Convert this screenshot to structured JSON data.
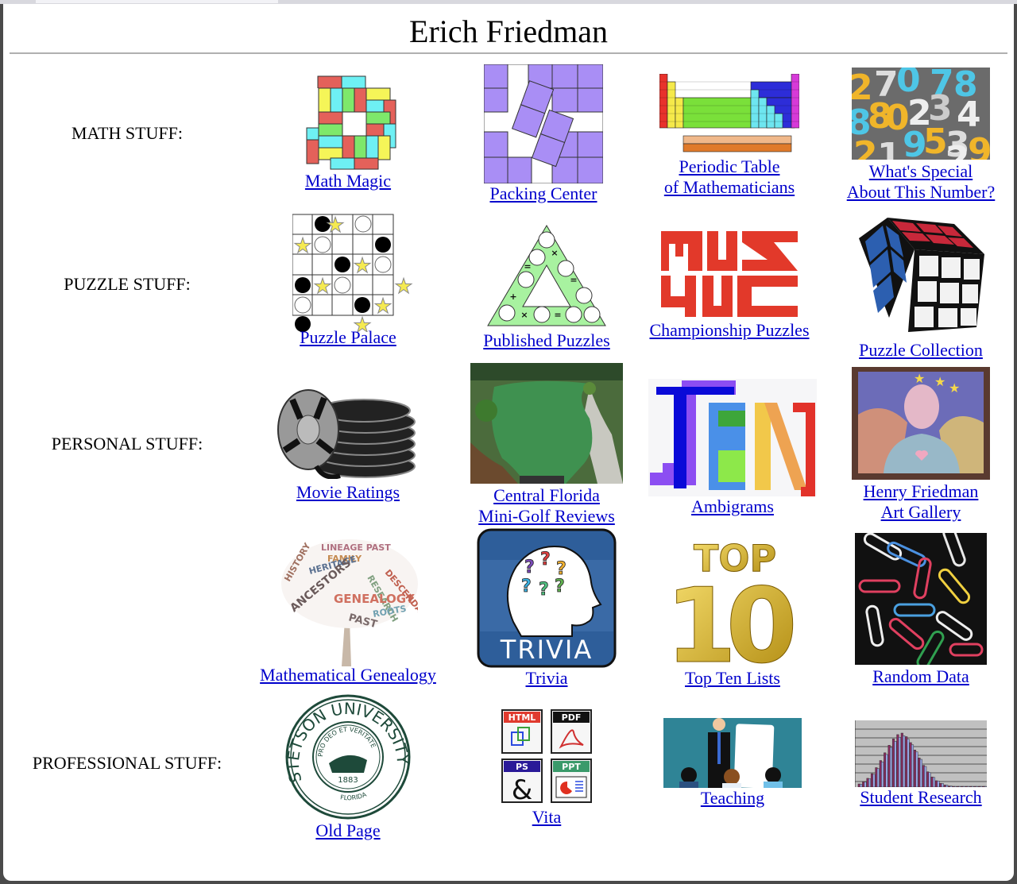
{
  "page": {
    "title": "Erich Friedman"
  },
  "rows": [
    {
      "label": "MATH STUFF:",
      "items": [
        {
          "icon": "domino-ring-icon",
          "lines": [
            "Math Magic"
          ]
        },
        {
          "icon": "square-packing-icon",
          "lines": [
            "Packing Center"
          ]
        },
        {
          "icon": "periodic-table-icon",
          "lines": [
            "Periodic Table",
            "of Mathematicians"
          ]
        },
        {
          "icon": "numbers-collage-icon",
          "lines": [
            "What's Special",
            "About This Number?"
          ]
        }
      ]
    },
    {
      "label": "PUZZLE STUFF:",
      "items": [
        {
          "icon": "grid-puzzle-icon",
          "lines": [
            "Puzzle Palace"
          ]
        },
        {
          "icon": "triangle-puzzle-icon",
          "lines": [
            "Published Puzzles"
          ]
        },
        {
          "icon": "puzzle-logo-icon",
          "lines": [
            "Championship Puzzles"
          ]
        },
        {
          "icon": "rubiks-cube-icon",
          "lines": [
            "Puzzle Collection"
          ]
        }
      ]
    },
    {
      "label": "PERSONAL STUFF:",
      "items": [
        {
          "icon": "film-reels-icon",
          "lines": [
            "Movie Ratings"
          ]
        },
        {
          "icon": "mini-golf-photo-icon",
          "lines": [
            "Central Florida",
            "Mini-Golf Reviews"
          ]
        },
        {
          "icon": "ambigram-ten-icon",
          "lines": [
            "Ambigrams"
          ]
        },
        {
          "icon": "portrait-painting-icon",
          "lines": [
            "Henry Friedman",
            "Art Gallery"
          ]
        }
      ]
    },
    {
      "label": "",
      "items": [
        {
          "icon": "word-cloud-tree-icon",
          "lines": [
            "Mathematical Genealogy"
          ]
        },
        {
          "icon": "trivia-head-icon",
          "lines": [
            "Trivia"
          ],
          "icon_text": "TRIVIA"
        },
        {
          "icon": "top-ten-icon",
          "lines": [
            "Top Ten Lists"
          ],
          "icon_text": "TOP 10"
        },
        {
          "icon": "paper-clips-icon",
          "lines": [
            "Random Data"
          ]
        }
      ]
    },
    {
      "label": "PROFESSIONAL STUFF:",
      "items": [
        {
          "icon": "university-seal-icon",
          "lines": [
            "Old Page"
          ],
          "icon_text": [
            "STETSON UNIVERSITY",
            "PRO DEO ET VERITATE",
            "1883",
            "FLORIDA"
          ]
        },
        {
          "icon": "document-formats-icon",
          "lines": [
            "Vita"
          ],
          "icon_text": [
            "HTML",
            "PDF",
            "PS",
            "PPT"
          ]
        },
        {
          "icon": "teaching-presentation-icon",
          "lines": [
            "Teaching"
          ]
        },
        {
          "icon": "histogram-icon",
          "lines": [
            "Student Research"
          ]
        }
      ]
    }
  ],
  "colors": {
    "link": "#0000cc"
  }
}
